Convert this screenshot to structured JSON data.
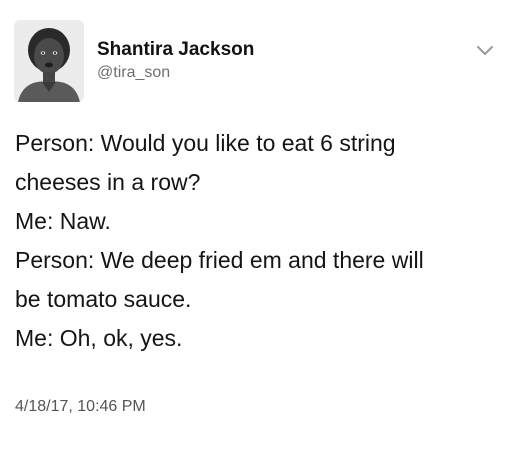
{
  "author": {
    "display_name": "Shantira Jackson",
    "handle": "@tira_son",
    "avatar_icon": "profile-photo",
    "menu_icon": "chevron-down-icon"
  },
  "tweet": {
    "lines": [
      "Person: Would you like to eat 6 string",
      "cheeses in a row?",
      "Me: Naw.",
      "Person: We deep fried em and there will",
      "be tomato sauce.",
      "Me: Oh, ok, yes."
    ],
    "timestamp": "4/18/17, 10:46 PM"
  },
  "colors": {
    "name": "#111111",
    "handle": "#6f6f6f",
    "text": "#151515",
    "timestamp": "#555555",
    "background": "#ffffff"
  }
}
